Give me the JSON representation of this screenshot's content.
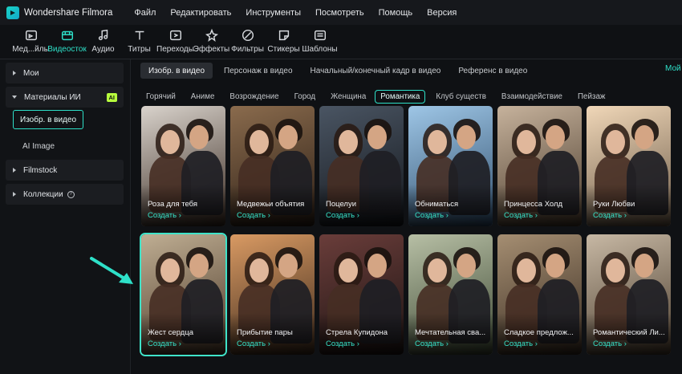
{
  "app": {
    "title": "Wondershare Filmora"
  },
  "menu": [
    "Файл",
    "Редактировать",
    "Инструменты",
    "Посмотреть",
    "Помощь",
    "Версия"
  ],
  "toolbar": [
    {
      "label": "Мед...йлы",
      "icon": "media-icon"
    },
    {
      "label": "Видеосток",
      "icon": "stock-video-icon",
      "active": true
    },
    {
      "label": "Аудио",
      "icon": "music-note-icon"
    },
    {
      "label": "Титры",
      "icon": "text-icon"
    },
    {
      "label": "Переходы",
      "icon": "transition-icon"
    },
    {
      "label": "Эффекты",
      "icon": "effects-icon"
    },
    {
      "label": "Фильтры",
      "icon": "filters-icon"
    },
    {
      "label": "Стикеры",
      "icon": "stickers-icon"
    },
    {
      "label": "Шаблоны",
      "icon": "templates-icon"
    }
  ],
  "sidebar": {
    "mine": "Мои",
    "ai_materials": "Материалы ИИ",
    "ai_badge": "AI",
    "image_to_video": "Изобр. в видео",
    "ai_image": "AI Image",
    "filmstock": "Filmstock",
    "collections": "Коллекции"
  },
  "tabs": [
    "Изобр. в видео",
    "Персонаж в видео",
    "Начальный/конечный кадр в видео",
    "Референс в видео"
  ],
  "tab_more": "Мой",
  "categories": [
    "Горячий",
    "Аниме",
    "Возрождение",
    "Город",
    "Женщина",
    "Романтика",
    "Клуб существ",
    "Взаимодействие",
    "Пейзаж"
  ],
  "active_category": "Романтика",
  "create_label": "Создать",
  "cards": [
    {
      "title": "Роза для тебя",
      "bg1": "#d9d3cc",
      "bg2": "#3a2b22"
    },
    {
      "title": "Медвежьи объятия",
      "bg1": "#8a6b4d",
      "bg2": "#2c1f16"
    },
    {
      "title": "Поцелуи",
      "bg1": "#4a5563",
      "bg2": "#14171c"
    },
    {
      "title": "Обниматься",
      "bg1": "#9ec6e6",
      "bg2": "#32506e"
    },
    {
      "title": "Принцесса Холд",
      "bg1": "#c6b29c",
      "bg2": "#4a3b2c"
    },
    {
      "title": "Руки Любви",
      "bg1": "#f0d7b8",
      "bg2": "#6b5a48"
    },
    {
      "title": "Жест сердца",
      "bg1": "#bfae93",
      "bg2": "#4d3a2a"
    },
    {
      "title": "Прибытие пары",
      "bg1": "#d99a63",
      "bg2": "#3d2a1c"
    },
    {
      "title": "Стрела Купидона",
      "bg1": "#6a3d3a",
      "bg2": "#1d1413"
    },
    {
      "title": "Мечтательная сва...",
      "bg1": "#b7bfa5",
      "bg2": "#3f4a35"
    },
    {
      "title": "Сладкое предлож...",
      "bg1": "#a58e72",
      "bg2": "#3a2d22"
    },
    {
      "title": "Романтический Ли...",
      "bg1": "#c7b8a4",
      "bg2": "#4d3f30"
    }
  ],
  "colors": {
    "accent": "#2ee0c8",
    "ai_badge": "#b7ff3d"
  }
}
